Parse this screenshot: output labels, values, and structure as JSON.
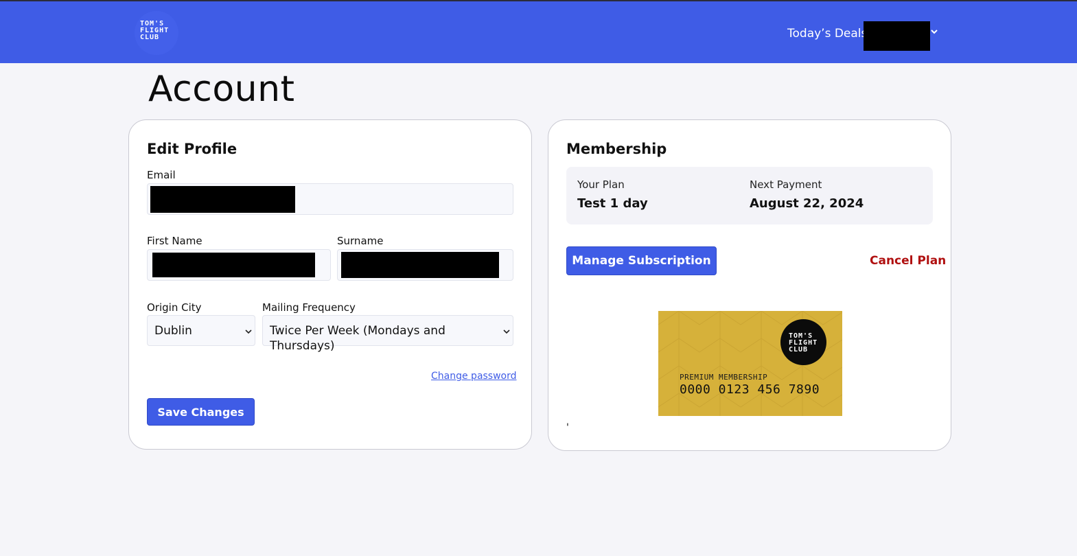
{
  "header": {
    "logo_lines": [
      "TOM'S",
      "FLIGHT",
      "CLUB"
    ],
    "deals_label": "Today’s Deals",
    "user_menu_chevron": "chevron-down-icon",
    "brand_color": "#3f5ce6"
  },
  "page": {
    "title": "Account"
  },
  "edit_profile": {
    "title": "Edit Profile",
    "email_label": "Email",
    "first_name_label": "First Name",
    "surname_label": "Surname",
    "origin_city_label": "Origin City",
    "origin_city_value": "Dublin",
    "mailing_frequency_label": "Mailing Frequency",
    "mailing_frequency_value": "Twice Per Week (Mondays and Thursdays)",
    "change_password_label": "Change password",
    "save_label": "Save Changes"
  },
  "membership": {
    "title": "Membership",
    "plan_label": "Your Plan",
    "plan_value": "Test 1 day",
    "next_payment_label": "Next Payment",
    "next_payment_value": "August 22, 2024",
    "manage_label": "Manage Subscription",
    "cancel_label": "Cancel Plan",
    "cancel_color": "#b01010",
    "card": {
      "logo_lines": [
        "TOM'S",
        "FLIGHT",
        "CLUB"
      ],
      "type": "PREMIUM MEMBERSHIP",
      "number": "0000 0123 456 7890",
      "color": "#d6b13a"
    },
    "stray_text": "'"
  }
}
